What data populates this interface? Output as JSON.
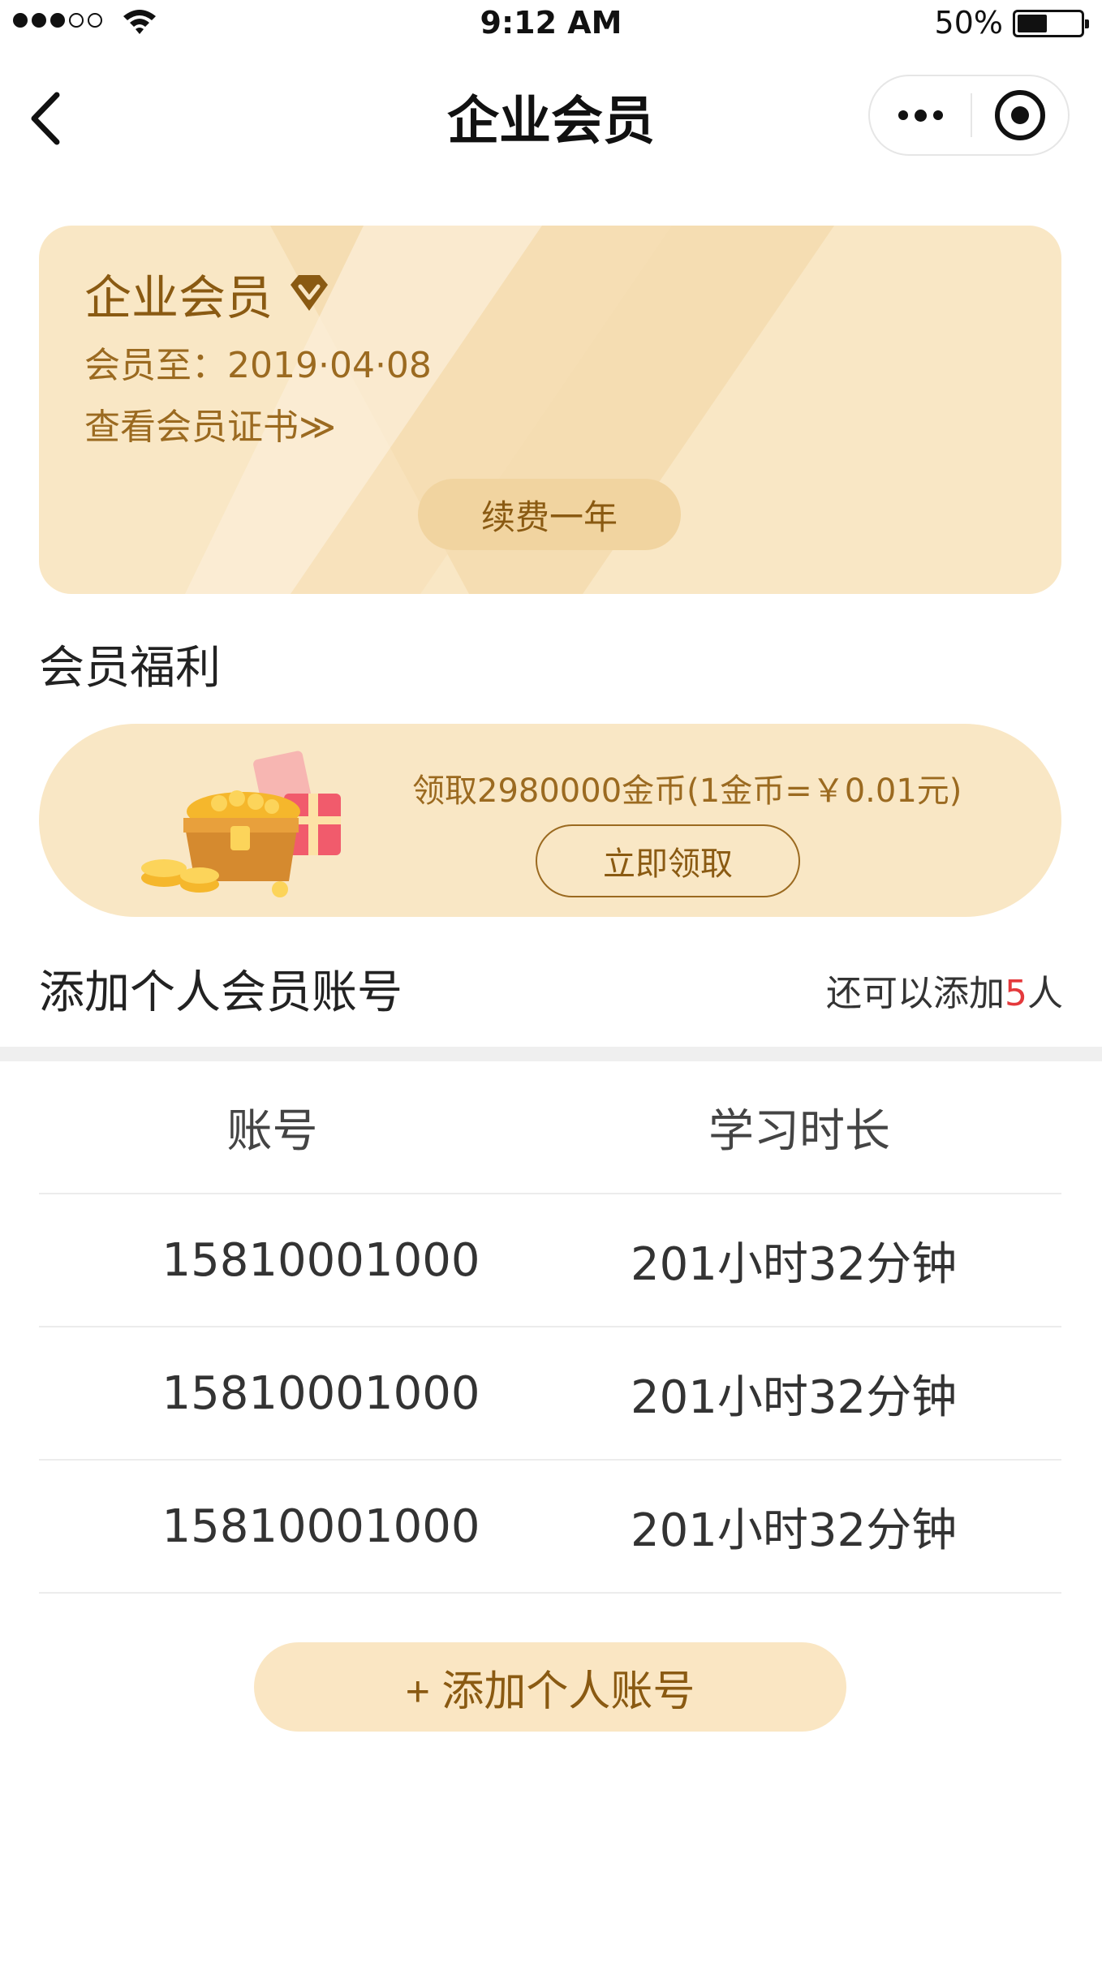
{
  "status_bar": {
    "time": "9:12 AM",
    "battery": "50%",
    "signal_icon": "signal-dots-icon",
    "wifi_icon": "wifi-icon",
    "battery_icon": "battery-icon"
  },
  "nav": {
    "title": "企业会员",
    "back_icon": "chevron-left-icon",
    "more_icon": "more-dots-icon",
    "close_icon": "target-circle-icon"
  },
  "member_card": {
    "title": "企业会员",
    "badge_icon": "vip-diamond-icon",
    "expiry": "会员至：2019·04·08",
    "certificate_link": "查看会员证书≫",
    "renew_label": "续费一年"
  },
  "benefits": {
    "section_title": "会员福利",
    "text": "领取2980000金币(1金币=￥0.01元)",
    "claim_label": "立即领取",
    "illustration": "treasure-chest-icon"
  },
  "accounts": {
    "section_title": "添加个人会员账号",
    "remain_prefix": "还可以添加",
    "remain_count": "5",
    "remain_suffix": "人",
    "columns": [
      "账号",
      "学习时长"
    ],
    "rows": [
      {
        "account": "15810001000",
        "duration": "201小时32分钟"
      },
      {
        "account": "15810001000",
        "duration": "201小时32分钟"
      },
      {
        "account": "15810001000",
        "duration": "201小时32分钟"
      }
    ],
    "add_label": "+ 添加个人账号"
  },
  "colors": {
    "accent_text": "#8a5a12",
    "card_bg": "#f9e7c5",
    "highlight": "#e4393c"
  }
}
